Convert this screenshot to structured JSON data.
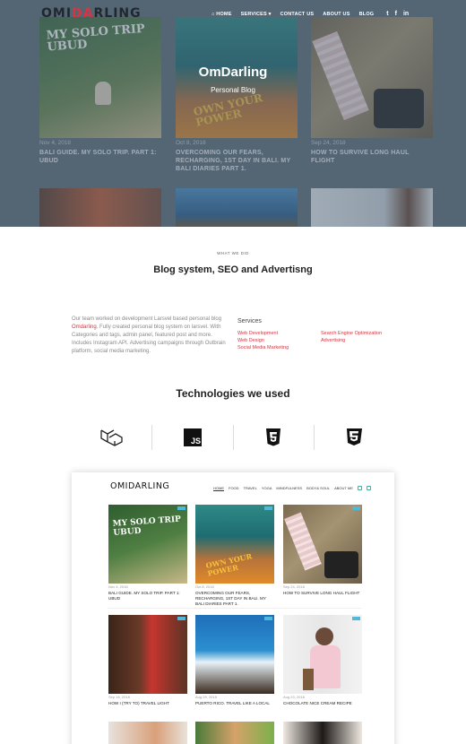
{
  "header": {
    "logo_left": "OMI",
    "logo_x": "DA",
    "logo_right": "RLING",
    "nav": [
      "HOME",
      "SERVICES",
      "CONTACT US",
      "ABOUT US",
      "BLOG"
    ],
    "social": [
      "t",
      "f",
      "in"
    ]
  },
  "hero": {
    "title": "OmDarling",
    "subtitle": "Personal Blog",
    "posts": [
      {
        "date": "Nov 4, 2018",
        "title": "BALI GUIDE. MY SOLO TRIP. PART 1: UBUD"
      },
      {
        "date": "Oct 8, 2018",
        "title": "OVERCOMING OUR FEARS, RECHARGING, 1ST DAY IN BALI. MY BALI DIARIES PART 1."
      },
      {
        "date": "Sep 24, 2018",
        "title": "HOW TO SURVIVE LONG HAUL FLIGHT"
      }
    ],
    "img1_text": "MY SOLO TRIP UBUD",
    "img2_text": "OWN YOUR POWER"
  },
  "what_we_did": {
    "eyebrow": "WHAT WE DID",
    "title": "Blog system, SEO and Advertisng",
    "desc_prefix": "Our team worked on development Larsvel based personal blog ",
    "desc_link": "Omdarling",
    "desc_suffix": ". Fully created personal blog system on larsvel. With Categories and tags, admin panel, featured post and more. Includes Instagram API. Advertising campaigns through Outbrain platform, social media marketing.",
    "services_label": "Services",
    "services_col1": [
      "Web Development",
      "Web Design",
      "Social Media Marketing"
    ],
    "services_col2": [
      "Search Engine Optimization",
      "Advertising"
    ]
  },
  "technologies": {
    "title": "Technologies we used",
    "items": [
      "laravel-icon",
      "js-icon",
      "html5-icon",
      "css3-icon"
    ]
  },
  "mockup": {
    "logo": "OMIDARLING",
    "nav": [
      "HOME",
      "FOOD",
      "TRAVEL",
      "YOGA",
      "MINDFULNESS",
      "BODY& SOUL",
      "ABOUT ME"
    ],
    "posts": [
      {
        "date": "Nov 4, 2018",
        "title": "BALI GUIDE. MY SOLO TRIP. PART 1: UBUD"
      },
      {
        "date": "Oct 8, 2018",
        "title": "OVERCOMING OUR FEARS, RECHARGING, 1ST DAY IN BALI. MY BALI DIARIES PART 1."
      },
      {
        "date": "Sep 24, 2018",
        "title": "HOW TO SURVIVE LONG HAUL FLIGHT"
      },
      {
        "date": "Sep 16, 2018",
        "title": "HOW I (TRY TO) TRAVEL LIGHT"
      },
      {
        "date": "Aug 29, 2018",
        "title": "PUERTO RICO. TRAVEL LIKE A LOCAL"
      },
      {
        "date": "Aug 23, 2018",
        "title": "CHOCOLATE NICE CREAM RECIPE"
      }
    ]
  },
  "colors": {
    "accent": "#d8333f",
    "teal": "#3bb3a0"
  }
}
